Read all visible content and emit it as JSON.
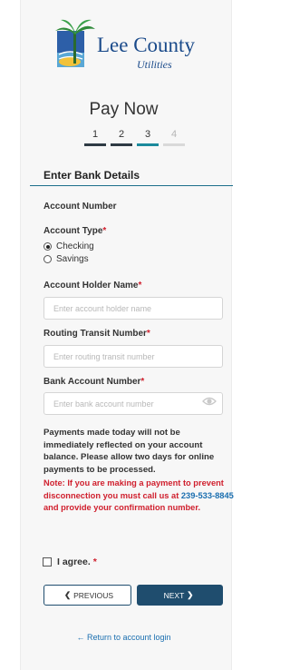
{
  "brand": {
    "name": "Lee County",
    "subtitle": "Utilities"
  },
  "page": {
    "title": "Pay Now"
  },
  "steps": [
    {
      "label": "1",
      "state": "done"
    },
    {
      "label": "2",
      "state": "done"
    },
    {
      "label": "3",
      "state": "active"
    },
    {
      "label": "4",
      "state": "future"
    }
  ],
  "form": {
    "section_title": "Enter Bank Details",
    "account_number_label": "Account Number",
    "account_type": {
      "label": "Account Type",
      "required_mark": "*",
      "options": [
        "Checking",
        "Savings"
      ],
      "selected": "Checking"
    },
    "holder_name": {
      "label": "Account Holder Name",
      "required_mark": "*",
      "placeholder": "Enter account holder name",
      "value": ""
    },
    "routing": {
      "label": "Routing Transit Number",
      "required_mark": "*",
      "placeholder": "Enter routing transit number",
      "value": ""
    },
    "bank_account": {
      "label": "Bank Account Number",
      "required_mark": "*",
      "placeholder": "Enter bank account number",
      "value": ""
    },
    "notice": "Payments made today will not be immediately reflected on your account balance. Please allow two days for online payments to be processed.",
    "warning": {
      "before": "Note: If you are making a payment to prevent disconnection you must call us at ",
      "phone": "239-533-8845",
      "after": " and provide your confirmation number."
    },
    "agree": {
      "label": "I agree.",
      "required_mark": "*",
      "checked": false
    }
  },
  "buttons": {
    "previous": "PREVIOUS",
    "next": "NEXT"
  },
  "footer": {
    "return_link": "Return to account login"
  },
  "colors": {
    "brand_blue": "#1a4a8a",
    "accent_teal": "#1b8a9c",
    "button_navy": "#1f4d6e",
    "required_red": "#d0202e",
    "link_blue": "#1b6fb0"
  }
}
